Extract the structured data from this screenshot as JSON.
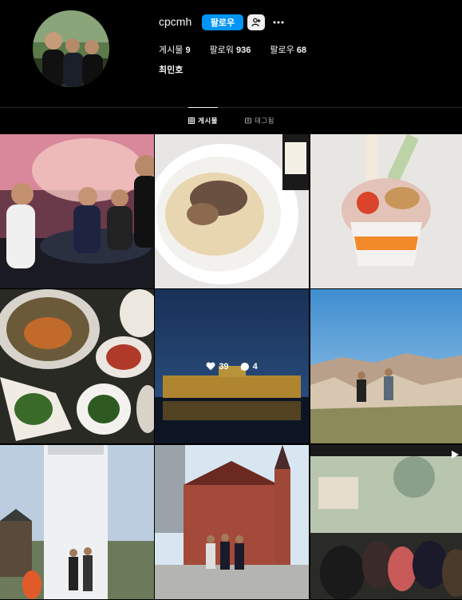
{
  "profile": {
    "username": "cpcmh",
    "follow_label": "팔로우",
    "suggest_icon": "person-plus-icon",
    "more_icon": "more-horizontal-icon",
    "stats": [
      {
        "label": "게시물",
        "value": "9"
      },
      {
        "label": "팔로워",
        "value": "936"
      },
      {
        "label": "팔로우",
        "value": "68"
      }
    ],
    "full_name": "최민호"
  },
  "tabs": [
    {
      "label": "게시물",
      "icon": "grid-icon",
      "active": true
    },
    {
      "label": "태그됨",
      "icon": "tag-icon",
      "active": false
    }
  ],
  "posts": [
    {
      "subject": "group-restaurant-photo"
    },
    {
      "subject": "pasta-with-mushrooms"
    },
    {
      "subject": "ice-cream-cup"
    },
    {
      "subject": "korean-side-dishes"
    },
    {
      "subject": "palace-at-night",
      "likes": "39",
      "comments": "4"
    },
    {
      "subject": "cappadocia-valley"
    },
    {
      "subject": "white-tower"
    },
    {
      "subject": "red-brick-church"
    },
    {
      "subject": "greenhouse-event",
      "is_reel": true
    }
  ],
  "colors": {
    "accent": "#0095f6",
    "background": "#000000",
    "divider": "#262626"
  }
}
